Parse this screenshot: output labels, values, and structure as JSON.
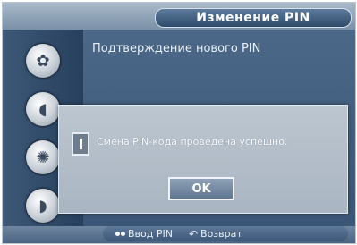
{
  "header": {
    "title": "Изменение PIN"
  },
  "main": {
    "subtitle": "Подтверждение нового PIN"
  },
  "dialog": {
    "message": "Смена PIN-кода проведена успешно.",
    "ok_label": "OK"
  },
  "footer": {
    "enter_pin_label": "Ввод PIN",
    "return_label": "Возврат"
  }
}
